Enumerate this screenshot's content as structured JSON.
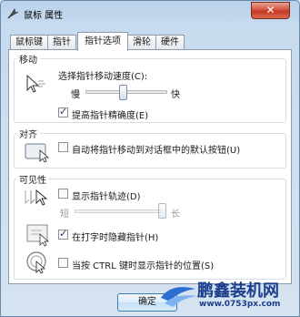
{
  "window": {
    "title": "鼠标 属性",
    "close_label": "✕"
  },
  "tabs": [
    {
      "label": "鼠标键",
      "active": false
    },
    {
      "label": "指针",
      "active": false
    },
    {
      "label": "指针选项",
      "active": true
    },
    {
      "label": "滑轮",
      "active": false
    },
    {
      "label": "硬件",
      "active": false
    }
  ],
  "motion": {
    "legend": "移动",
    "speed_label": "选择指针移动速度(C):",
    "slow_label": "慢",
    "fast_label": "快",
    "speed_level": 0.45,
    "precision_label": "提高指针精确度(E)",
    "precision_checked": true
  },
  "snap": {
    "legend": "对齐",
    "snap_label": "自动将指针移动到对话框中的默认按钮(U)",
    "snap_checked": false
  },
  "visibility": {
    "legend": "可见性",
    "trails_label": "显示指针轨迹(D)",
    "trails_checked": false,
    "short_label": "短",
    "long_label": "长",
    "trails_level": 1.0,
    "hide_label": "在打字时隐藏指针(H)",
    "hide_checked": true,
    "ctrl_label": "当按 CTRL 键时显示指针的位置(S)",
    "ctrl_checked": false
  },
  "buttons": {
    "ok_label": "确定"
  },
  "watermark": {
    "title": "鹏鑫装机网",
    "url": "www.0753px.com"
  },
  "colors": {
    "accent": "#1c3e8c",
    "close_red": "#c43a22",
    "panel_bg": "#ffffff"
  }
}
